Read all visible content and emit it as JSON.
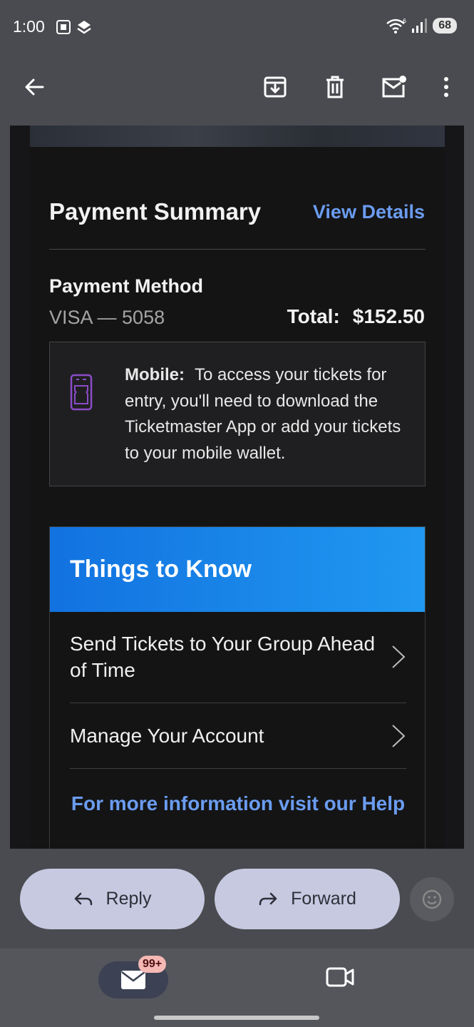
{
  "status_bar": {
    "time": "1:00",
    "battery": "68",
    "icons": [
      "screenshot-icon",
      "app-status-icon",
      "wifi-icon",
      "signal-icon"
    ]
  },
  "app_bar": {
    "icons": [
      "back-arrow-icon",
      "archive-icon",
      "trash-icon",
      "mark-unread-icon",
      "more-vert-icon"
    ]
  },
  "email": {
    "payment_summary_title": "Payment Summary",
    "view_details_label": "View Details",
    "payment_method_label": "Payment Method",
    "payment_method_value": "VISA  — 5058",
    "total_label": "Total:",
    "total_value": "$152.50",
    "mobile_notice": {
      "label": "Mobile:",
      "text": "To access your tickets for entry, you'll need to download the Ticketmaster App or add your tickets to your mobile wallet."
    },
    "things_to_know": {
      "title": "Things to Know",
      "items": [
        "Send Tickets to Your Group Ahead of Time",
        "Manage Your Account"
      ],
      "help_link": "For more information visit our Help"
    }
  },
  "actions": {
    "reply_label": "Reply",
    "forward_label": "Forward"
  },
  "bottom_nav": {
    "mail_badge": "99+"
  },
  "colors": {
    "link_blue": "#6b9cf0",
    "banner_blue": "#1a84ea",
    "pill_bg": "#c6c9e0",
    "mobile_icon_purple": "#8a4cc8"
  }
}
